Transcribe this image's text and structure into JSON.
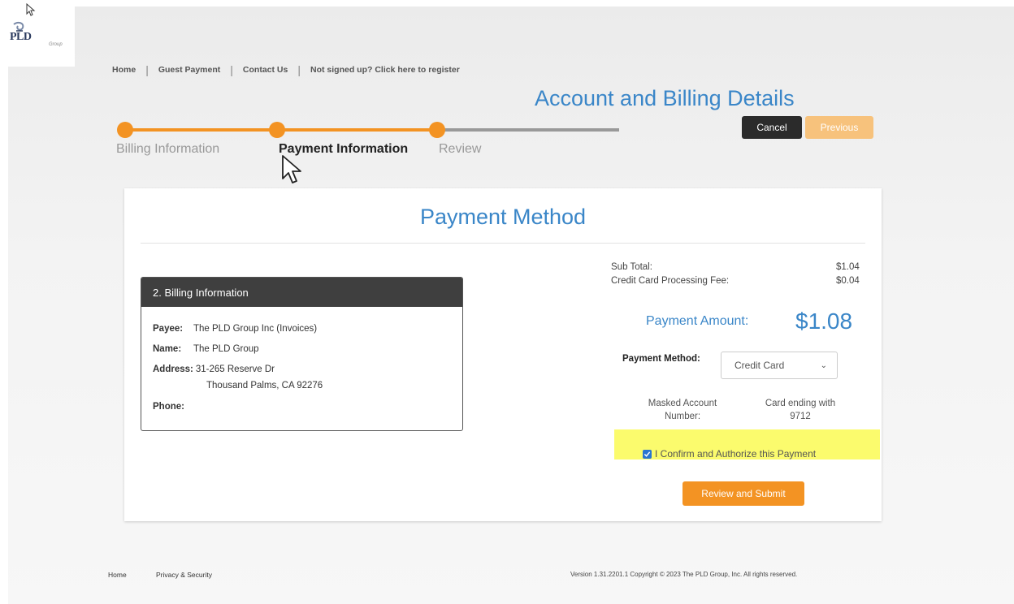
{
  "logo": {
    "text": "PLD",
    "subtext": "Group"
  },
  "nav": {
    "home": "Home",
    "guest_payment": "Guest Payment",
    "contact_us": "Contact Us",
    "register": "Not signed up? Click here to register",
    "sep": "|"
  },
  "page_title": "Account and Billing Details",
  "buttons": {
    "cancel": "Cancel",
    "previous": "Previous",
    "review_submit": "Review and Submit"
  },
  "steps": [
    {
      "label": "Billing Information",
      "state": "complete"
    },
    {
      "label": "Payment Information",
      "state": "active"
    },
    {
      "label": "Review",
      "state": "upcoming"
    }
  ],
  "panel_title": "Payment Method",
  "billing": {
    "header": "2. Billing Information",
    "payee_label": "Payee:",
    "payee": "The PLD Group Inc (Invoices)",
    "name_label": "Name:",
    "name": "The PLD Group",
    "address_label": "Address:",
    "address_line1": "31-265 Reserve Dr",
    "address_line2": "Thousand Palms, CA 92276",
    "phone_label": "Phone:",
    "phone": ""
  },
  "summary": {
    "subtotal_label": "Sub Total:",
    "subtotal": "$1.04",
    "fee_label": "Credit Card Processing Fee:",
    "fee": "$0.04",
    "amount_label": "Payment Amount:",
    "amount": "$1.08"
  },
  "payment_method": {
    "label": "Payment Method:",
    "selected": "Credit Card"
  },
  "account": {
    "masked_label_1": "Masked Account",
    "masked_label_2": "Number:",
    "card_line_1": "Card ending with",
    "card_line_2": "9712"
  },
  "confirm_text": "I Confirm and Authorize this Payment",
  "footer": {
    "home": "Home",
    "privacy": "Privacy & Security",
    "copyright": "Version 1.31.2201.1 Copyright © 2023 The PLD Group, Inc. All rights reserved."
  },
  "colors": {
    "accent_blue": "#3a86c8",
    "accent_orange": "#f39323",
    "highlight": "#fbfb6d"
  },
  "icons": [
    "cursor-icon",
    "checkbox-checked-icon",
    "chevron-down-icon",
    "logo-swirl-icon"
  ]
}
